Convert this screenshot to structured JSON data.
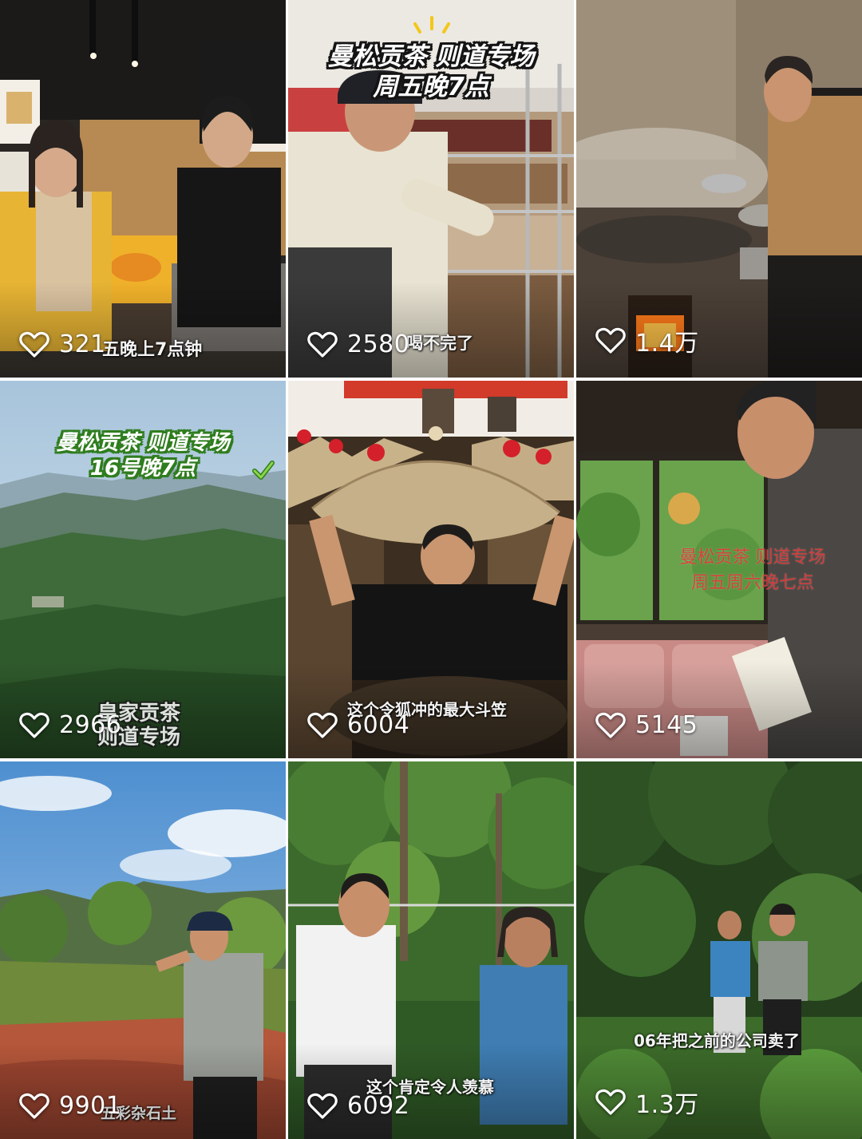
{
  "tiles": [
    {
      "likes": "321",
      "subtitle": "五晚上7点钟"
    },
    {
      "likes": "2580",
      "subtitle": "喝不完了",
      "promo_lines": [
        "曼松贡茶  则道专场",
        "周五晚7点"
      ]
    },
    {
      "likes": "1.4万"
    },
    {
      "likes": "2966",
      "promo_lines": [
        "曼松贡茶  则道专场",
        "16号晚7点"
      ],
      "overlay_lines": [
        "皇家贡茶",
        "则道专场"
      ]
    },
    {
      "likes": "6004",
      "subtitle": "这个令狐冲的最大斗笠"
    },
    {
      "likes": "5145",
      "promo_lines": [
        "曼松贡茶 则道专场",
        "周五周六晚七点"
      ]
    },
    {
      "likes": "9901",
      "subtitle": "五彩杂石土"
    },
    {
      "likes": "6092",
      "subtitle": "这个肯定令人羡慕"
    },
    {
      "likes": "1.3万",
      "subtitle": "06年把之前的公司卖了"
    }
  ],
  "colors": {
    "heart_outline": "#ffffff",
    "promo_outline_green": "#2f7d1e",
    "promo_outline_dark": "#141414",
    "handwritten_red": "#e23b3b"
  },
  "icons": {
    "like": "heart-outline-icon",
    "check": "checkmark-icon"
  }
}
